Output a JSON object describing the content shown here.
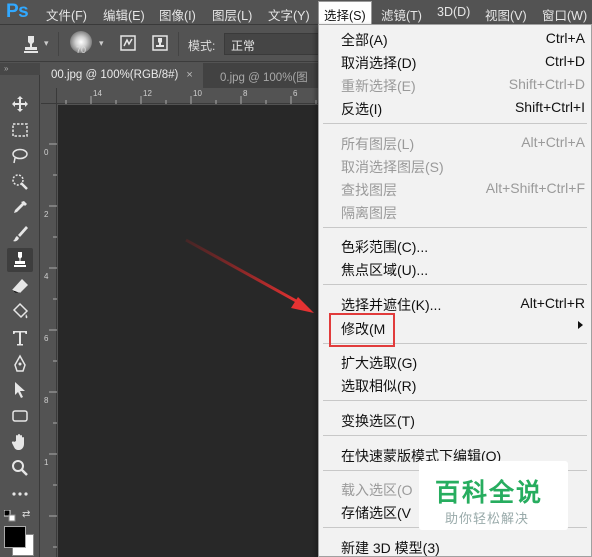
{
  "app": {
    "logo": "Ps"
  },
  "menubar": {
    "items": [
      {
        "label": "文件(F)"
      },
      {
        "label": "编辑(E)"
      },
      {
        "label": "图像(I)"
      },
      {
        "label": "图层(L)"
      },
      {
        "label": "文字(Y)"
      },
      {
        "label": "选择(S)"
      },
      {
        "label": "滤镜(T)"
      },
      {
        "label": "3D(D)"
      },
      {
        "label": "视图(V)"
      },
      {
        "label": "窗口(W)"
      }
    ],
    "active_item": "选择(S)"
  },
  "options_bar": {
    "brush_size": "70",
    "mode_label": "模式:",
    "mode_value": "正常"
  },
  "tabs": [
    {
      "label": "00.jpg @ 100%(RGB/8#)",
      "close": "×",
      "active": true
    },
    {
      "label": "0.jpg @ 100%(图",
      "active": false
    }
  ],
  "rulers": {
    "top_ticks": [
      "14",
      "12",
      "10",
      "8",
      "6",
      "4"
    ],
    "left_ticks": [
      "0",
      "2",
      "4",
      "6",
      "8",
      "1"
    ]
  },
  "toolbar": {
    "icons": [
      "move-icon",
      "marquee-icon",
      "lasso-icon",
      "quick-select-icon",
      "eyedropper-icon",
      "brush-icon",
      "clone-stamp-icon",
      "eraser-icon",
      "paint-bucket-icon",
      "type-icon",
      "pen-icon",
      "path-select-icon",
      "shape-icon",
      "hand-icon",
      "zoom-icon",
      "more-icon"
    ],
    "selected": "clone-stamp-icon",
    "foreground_color": "#000000",
    "background_color": "#ffffff"
  },
  "select_menu": {
    "groups": [
      [
        {
          "label": "全部(A)",
          "shortcut": "Ctrl+A",
          "enabled": true
        },
        {
          "label": "取消选择(D)",
          "shortcut": "Ctrl+D",
          "enabled": true
        },
        {
          "label": "重新选择(E)",
          "shortcut": "Shift+Ctrl+D",
          "enabled": false
        },
        {
          "label": "反选(I)",
          "shortcut": "Shift+Ctrl+I",
          "enabled": true
        }
      ],
      [
        {
          "label": "所有图层(L)",
          "shortcut": "Alt+Ctrl+A",
          "enabled": false
        },
        {
          "label": "取消选择图层(S)",
          "shortcut": "",
          "enabled": false
        },
        {
          "label": "查找图层",
          "shortcut": "Alt+Shift+Ctrl+F",
          "enabled": false
        },
        {
          "label": "隔离图层",
          "shortcut": "",
          "enabled": false
        }
      ],
      [
        {
          "label": "色彩范围(C)...",
          "shortcut": "",
          "enabled": true
        },
        {
          "label": "焦点区域(U)...",
          "shortcut": "",
          "enabled": true
        }
      ],
      [
        {
          "label": "选择并遮住(K)...",
          "shortcut": "Alt+Ctrl+R",
          "enabled": true
        },
        {
          "label": "修改(M",
          "shortcut": "",
          "enabled": true,
          "submenu": true
        }
      ],
      [
        {
          "label": "扩大选取(G)",
          "shortcut": "",
          "enabled": true
        },
        {
          "label": "选取相似(R)",
          "shortcut": "",
          "enabled": true
        }
      ],
      [
        {
          "label": "变换选区(T)",
          "shortcut": "",
          "enabled": true
        }
      ],
      [
        {
          "label": "在快速蒙版模式下编辑(Q)",
          "shortcut": "",
          "enabled": true
        }
      ],
      [
        {
          "label": "载入选区(O",
          "shortcut": "",
          "enabled": false
        },
        {
          "label": "存储选区(V",
          "shortcut": "",
          "enabled": true
        }
      ],
      [
        {
          "label": "新建 3D 模型(3)",
          "shortcut": "",
          "enabled": true
        }
      ]
    ],
    "highlighted_item": "修改(M"
  },
  "watermark": {
    "title": "百科全说",
    "subtitle": "助你轻松解决"
  },
  "colors": {
    "annotation_red": "#e13b3b",
    "watermark_green": "#27ad5f",
    "ps_blue": "#31a8ff"
  }
}
